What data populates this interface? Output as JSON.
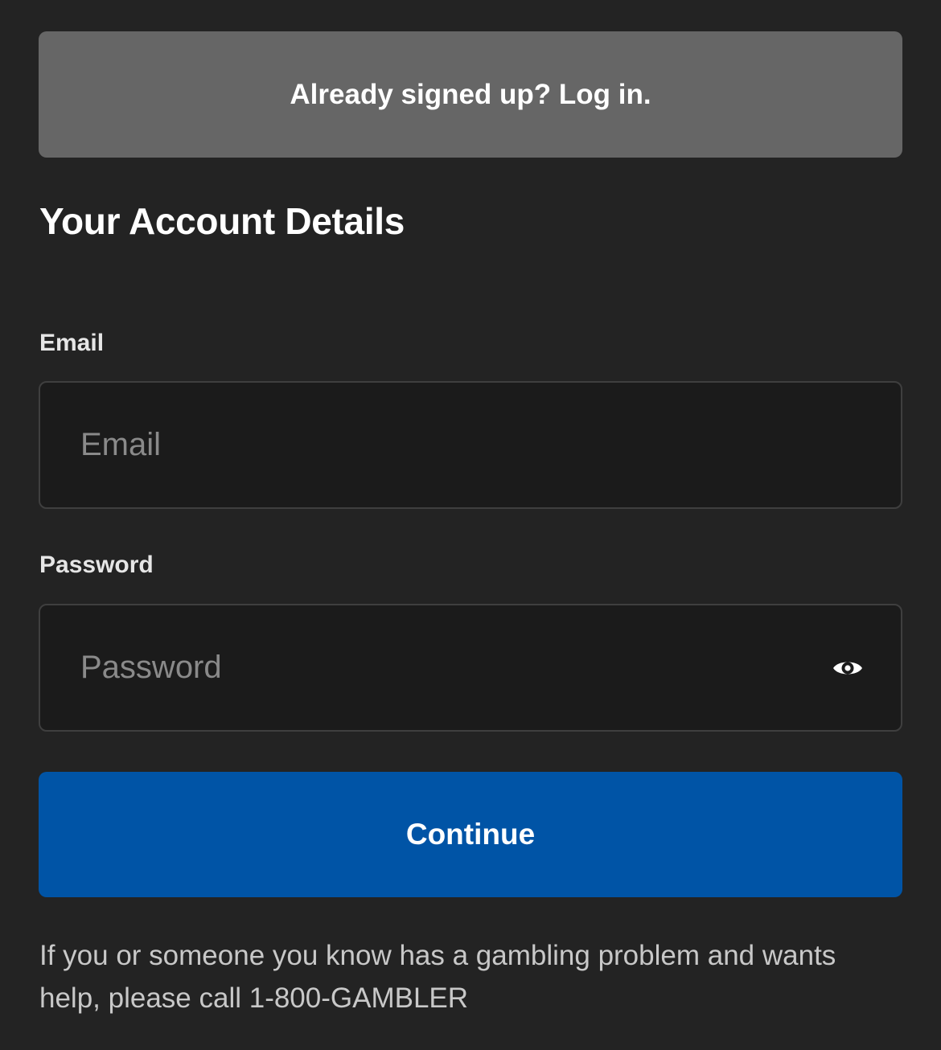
{
  "banner": {
    "login_label": "Already signed up? Log in."
  },
  "form": {
    "title": "Your Account Details",
    "email": {
      "label": "Email",
      "value": "",
      "placeholder": "Email"
    },
    "password": {
      "label": "Password",
      "value": "",
      "placeholder": "Password",
      "toggle_icon": "eye-icon"
    },
    "continue_label": "Continue"
  },
  "footer": {
    "disclaimer": "If you or someone you know has a gambling problem and wants help, please call 1-800-GAMBLER"
  },
  "colors": {
    "background": "#232323",
    "banner": "#666666",
    "input_background": "#1b1b1b",
    "primary_button": "#0054a6"
  }
}
